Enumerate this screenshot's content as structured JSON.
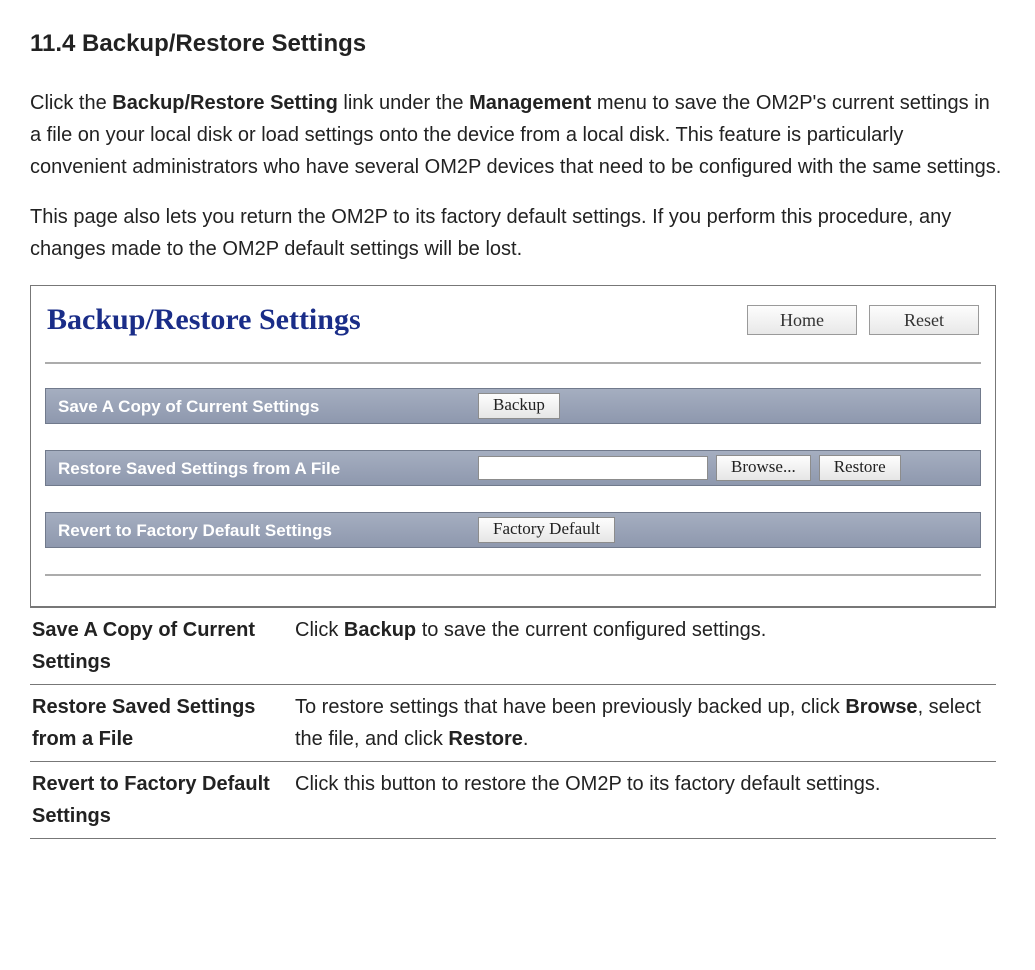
{
  "heading": "11.4 Backup/Restore Settings",
  "intro": {
    "pre1": "Click the ",
    "bold1": "Backup/Restore Setting",
    "mid1": " link under the ",
    "bold2": "Management",
    "post1": " menu to save the OM2P's current settings in a file on your local disk or load settings onto the device from a local disk. This feature is particularly convenient administrators who have several OM2P devices that need to be configured with the same settings."
  },
  "intro2": "This page also lets you return the OM2P to its factory default settings. If you perform this procedure, any changes made to the OM2P default settings will be lost.",
  "screenshot": {
    "title": "Backup/Restore Settings",
    "nav": {
      "home": "Home",
      "reset": "Reset"
    },
    "rows": {
      "save_label": "Save A Copy of Current Settings",
      "backup_btn": "Backup",
      "restore_label": "Restore Saved Settings from A File",
      "file_placeholder": "",
      "browse_btn": "Browse...",
      "restore_btn": "Restore",
      "revert_label": "Revert to Factory Default Settings",
      "factory_btn": "Factory Default"
    }
  },
  "desc": {
    "r1_term": "Save A Copy of Current Settings",
    "r1_pre": "Click ",
    "r1_b1": "Backup",
    "r1_post": " to save the current configured settings.",
    "r2_term": "Restore Saved Settings from a File",
    "r2_pre": "To restore settings that have been previously backed up, click ",
    "r2_b1": "Browse",
    "r2_mid": ", select the file, and click ",
    "r2_b2": "Restore",
    "r2_post": ".",
    "r3_term": "Revert to Factory Default Settings",
    "r3_def": "Click this button to restore the OM2P to its factory default settings."
  }
}
